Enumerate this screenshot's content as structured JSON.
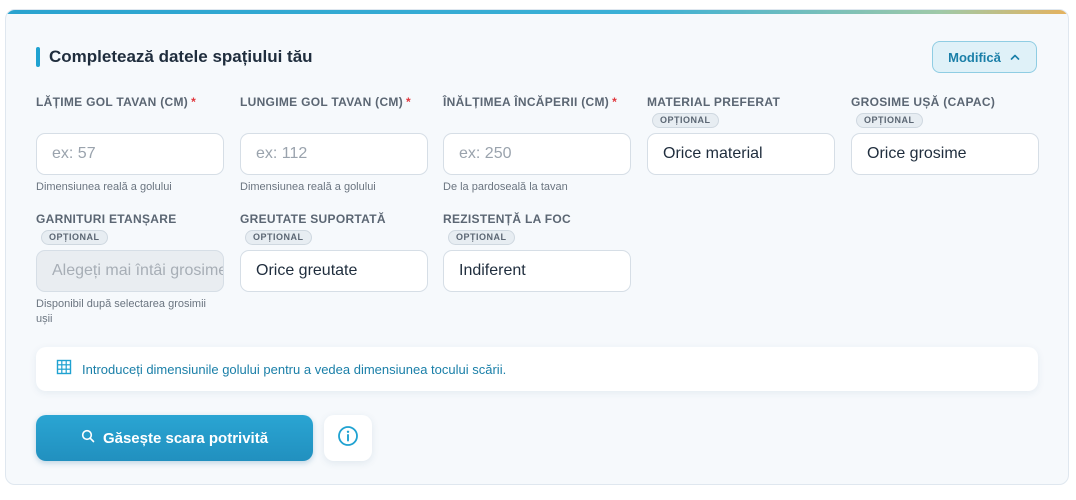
{
  "form": {
    "title": "Completează datele spațiului tău",
    "modify_label": "Modifică",
    "optional_label": "OPȚIONAL",
    "fields": {
      "latime": {
        "label": "LĂȚIME GOL TAVAN (CM)",
        "required_mark": "*",
        "placeholder": "ex: 57",
        "help": "Dimensiunea reală a golului"
      },
      "lungime": {
        "label": "LUNGIME GOL TAVAN (CM)",
        "required_mark": "*",
        "placeholder": "ex: 112",
        "help": "Dimensiunea reală a golului"
      },
      "inaltime": {
        "label": "ÎNĂLȚIMEA ÎNCĂPERII (CM)",
        "required_mark": "*",
        "placeholder": "ex: 250",
        "help": "De la pardoseală la tavan"
      },
      "material": {
        "label": "MATERIAL PREFERAT",
        "value": "Orice material"
      },
      "grosime": {
        "label": "GROSIME UȘĂ (CAPAC)",
        "value": "Orice grosime"
      },
      "garnituri": {
        "label": "GARNITURI ETANȘARE",
        "value": "Alegeți mai întâi grosimea",
        "help": "Disponibil după selectarea grosimii ușii"
      },
      "greutate": {
        "label": "GREUTATE SUPORTATĂ",
        "value": "Orice greutate"
      },
      "rezistenta": {
        "label": "REZISTENȚĂ LA FOC",
        "value": "Indiferent"
      }
    },
    "info_text": "Introduceți dimensiunile golului pentru a vedea dimensiunea tocului scării.",
    "find_button": "Găsește scara potrivită"
  },
  "colors": {
    "accent": "#1fa2d1",
    "required": "#e0383e",
    "link": "#1a7fa8"
  },
  "icons": {
    "modify": "chevron-up-icon",
    "info_bar": "grid-icon",
    "find": "search-icon",
    "help": "info-icon"
  }
}
